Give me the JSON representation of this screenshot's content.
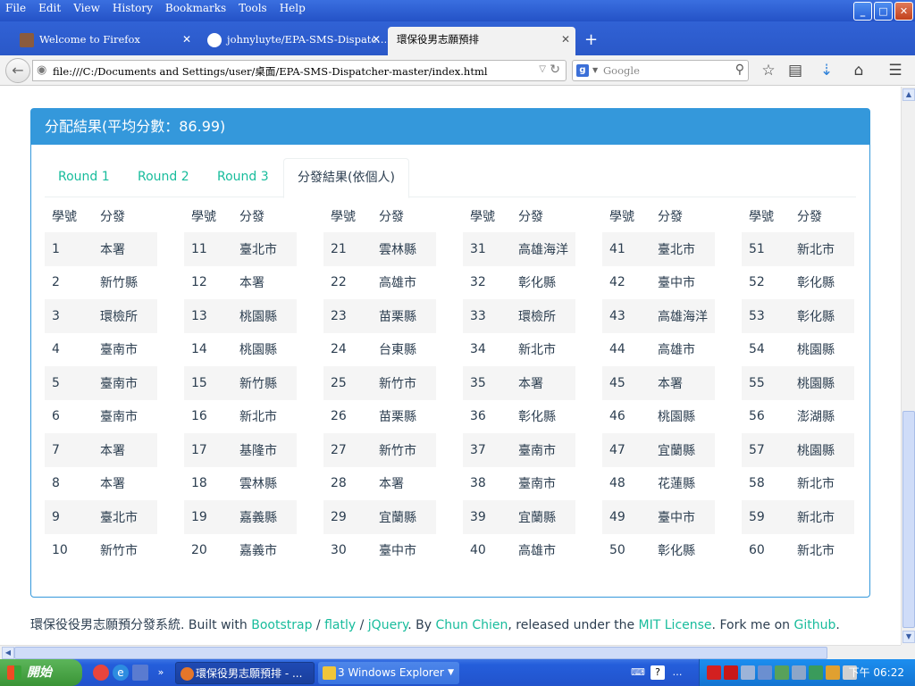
{
  "menu": [
    "File",
    "Edit",
    "View",
    "History",
    "Bookmarks",
    "Tools",
    "Help"
  ],
  "window_buttons": {
    "minimize": "_",
    "maximize": "□",
    "close": "✕"
  },
  "tabs": [
    {
      "title": "Welcome to Firefox",
      "close": "✕"
    },
    {
      "title": "johnyluyte/EPA-SMS-Dispatc…",
      "close": "✕"
    },
    {
      "title": "環保役男志願預排",
      "close": "✕"
    }
  ],
  "new_tab": "+",
  "address": {
    "url": "file:///C:/Documents and Settings/user/桌面/EPA-SMS-Dispatcher-master/index.html"
  },
  "search": {
    "placeholder": "Google"
  },
  "panel": {
    "title": "分配結果(平均分數：86.99)"
  },
  "result_tabs": [
    "Round 1",
    "Round 2",
    "Round 3",
    "分發結果(依個人)"
  ],
  "table_headers": {
    "id": "學號",
    "assign": "分發"
  },
  "assignments": [
    [
      [
        "1",
        "本署"
      ],
      [
        "2",
        "新竹縣"
      ],
      [
        "3",
        "環檢所"
      ],
      [
        "4",
        "臺南市"
      ],
      [
        "5",
        "臺南市"
      ],
      [
        "6",
        "臺南市"
      ],
      [
        "7",
        "本署"
      ],
      [
        "8",
        "本署"
      ],
      [
        "9",
        "臺北市"
      ],
      [
        "10",
        "新竹市"
      ]
    ],
    [
      [
        "11",
        "臺北市"
      ],
      [
        "12",
        "本署"
      ],
      [
        "13",
        "桃園縣"
      ],
      [
        "14",
        "桃園縣"
      ],
      [
        "15",
        "新竹縣"
      ],
      [
        "16",
        "新北市"
      ],
      [
        "17",
        "基隆市"
      ],
      [
        "18",
        "雲林縣"
      ],
      [
        "19",
        "嘉義縣"
      ],
      [
        "20",
        "嘉義市"
      ]
    ],
    [
      [
        "21",
        "雲林縣"
      ],
      [
        "22",
        "高雄市"
      ],
      [
        "23",
        "苗栗縣"
      ],
      [
        "24",
        "台東縣"
      ],
      [
        "25",
        "新竹市"
      ],
      [
        "26",
        "苗栗縣"
      ],
      [
        "27",
        "新竹市"
      ],
      [
        "28",
        "本署"
      ],
      [
        "29",
        "宜蘭縣"
      ],
      [
        "30",
        "臺中市"
      ]
    ],
    [
      [
        "31",
        "高雄海洋"
      ],
      [
        "32",
        "彰化縣"
      ],
      [
        "33",
        "環檢所"
      ],
      [
        "34",
        "新北市"
      ],
      [
        "35",
        "本署"
      ],
      [
        "36",
        "彰化縣"
      ],
      [
        "37",
        "臺南市"
      ],
      [
        "38",
        "臺南市"
      ],
      [
        "39",
        "宜蘭縣"
      ],
      [
        "40",
        "高雄市"
      ]
    ],
    [
      [
        "41",
        "臺北市"
      ],
      [
        "42",
        "臺中市"
      ],
      [
        "43",
        "高雄海洋"
      ],
      [
        "44",
        "高雄市"
      ],
      [
        "45",
        "本署"
      ],
      [
        "46",
        "桃園縣"
      ],
      [
        "47",
        "宜蘭縣"
      ],
      [
        "48",
        "花蓮縣"
      ],
      [
        "49",
        "臺中市"
      ],
      [
        "50",
        "彰化縣"
      ]
    ],
    [
      [
        "51",
        "新北市"
      ],
      [
        "52",
        "彰化縣"
      ],
      [
        "53",
        "彰化縣"
      ],
      [
        "54",
        "桃園縣"
      ],
      [
        "55",
        "桃園縣"
      ],
      [
        "56",
        "澎湖縣"
      ],
      [
        "57",
        "桃園縣"
      ],
      [
        "58",
        "新北市"
      ],
      [
        "59",
        "新北市"
      ],
      [
        "60",
        "新北市"
      ]
    ]
  ],
  "footer": {
    "p1": "環保役役男志願預分發系統. Built with ",
    "bootstrap": "Bootstrap",
    "sep1": " / ",
    "flatly": "flatly",
    "sep2": " / ",
    "jquery": "jQuery",
    "p2": ". By ",
    "author": "Chun Chien",
    "p3": ", released under the ",
    "license": "MIT License",
    "p4": ". Fork me on ",
    "github": "Github",
    "p5": "."
  },
  "taskbar": {
    "start": "開始",
    "tasks": [
      "環保役男志願預排 - ...",
      "3 Windows Explorer"
    ],
    "clock": "下午 06:22"
  },
  "colors": {
    "primary": "#3498db",
    "link": "#18bc9c",
    "text": "#2c3e50"
  }
}
